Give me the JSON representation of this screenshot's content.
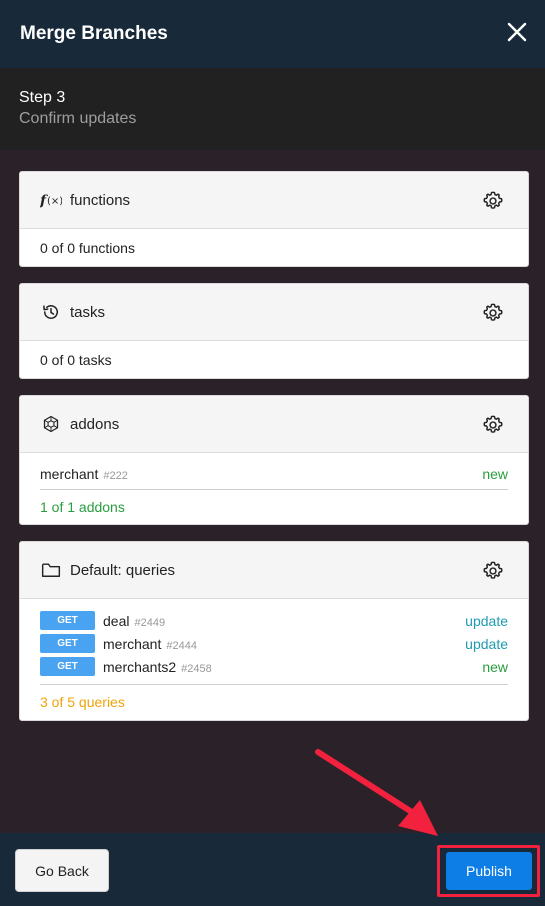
{
  "dialog": {
    "title": "Merge Branches",
    "close_icon": "close-icon"
  },
  "step": {
    "number": "Step 3",
    "subtitle": "Confirm updates"
  },
  "sections": {
    "functions": {
      "label": "functions",
      "icon": "function-icon",
      "summary": "0 of 0 functions"
    },
    "tasks": {
      "label": "tasks",
      "icon": "history-icon",
      "summary": "0 of 0 tasks"
    },
    "addons": {
      "label": "addons",
      "icon": "addon-icon",
      "items": [
        {
          "name": "merchant",
          "id": "#222",
          "status": "new"
        }
      ],
      "summary": "1 of 1 addons"
    },
    "queries": {
      "label": "Default: queries",
      "icon": "folder-icon",
      "items": [
        {
          "method": "GET",
          "name": "deal",
          "id": "#2449",
          "status": "update"
        },
        {
          "method": "GET",
          "name": "merchant",
          "id": "#2444",
          "status": "update"
        },
        {
          "method": "GET",
          "name": "merchants2",
          "id": "#2458",
          "status": "new"
        }
      ],
      "summary": "3 of 5 queries"
    }
  },
  "footer": {
    "back_label": "Go Back",
    "publish_label": "Publish"
  },
  "colors": {
    "header_bg": "#182a3a",
    "content_bg": "#2a2129",
    "publish_blue": "#0d7ee6",
    "status_new": "#2a9d3f",
    "status_update": "#1f9bb0",
    "summary_orange": "#f0a30a",
    "highlight_red": "#f2223e"
  }
}
